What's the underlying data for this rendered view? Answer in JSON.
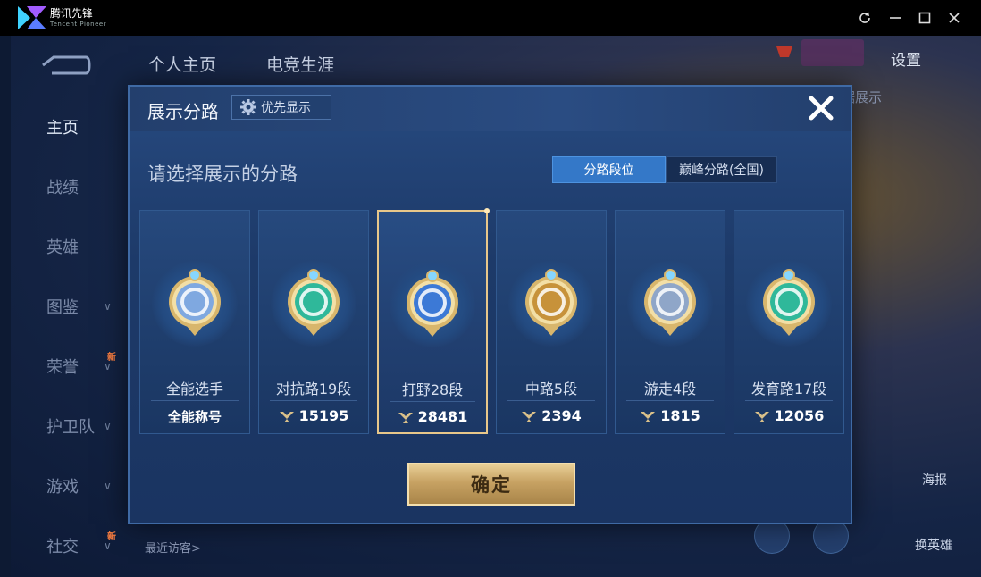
{
  "app": {
    "name": "腾讯先锋",
    "subtitle": "Tencent Pioneer"
  },
  "game": {
    "top_tabs": [
      "个人主页",
      "电竞生涯"
    ],
    "settings_label": "设置",
    "bg_hint": "和数据展示",
    "sidebar": [
      {
        "label": "主页",
        "has_arrow": false,
        "new": false,
        "active": true
      },
      {
        "label": "战绩",
        "has_arrow": false,
        "new": false,
        "active": false
      },
      {
        "label": "英雄",
        "has_arrow": false,
        "new": false,
        "active": false
      },
      {
        "label": "图鉴",
        "has_arrow": true,
        "new": false,
        "active": false
      },
      {
        "label": "荣誉",
        "has_arrow": true,
        "new": true,
        "active": false
      },
      {
        "label": "护卫队",
        "has_arrow": true,
        "new": false,
        "active": false
      },
      {
        "label": "游戏",
        "has_arrow": true,
        "new": false,
        "active": false
      },
      {
        "label": "社交",
        "has_arrow": true,
        "new": true,
        "active": false
      }
    ],
    "new_badge": "新",
    "visitors_label": "最近访客>",
    "poster_label": "海报",
    "switch_label": "换英雄"
  },
  "modal": {
    "title": "展示分路",
    "priority_label": "优先显示",
    "prompt": "请选择展示的分路",
    "segments": [
      "分路段位",
      "巅峰分路(全国)"
    ],
    "confirm_label": "确定",
    "cards": [
      {
        "rank": "全能选手",
        "bottom_text": "全能称号",
        "is_score": false,
        "emblem": "allround-emblem-icon",
        "accent": "#7fa8e0",
        "selected": false
      },
      {
        "rank": "对抗路19段",
        "bottom_text": "15195",
        "is_score": true,
        "emblem": "clash-lane-emblem-icon",
        "accent": "#2fb89a",
        "selected": false
      },
      {
        "rank": "打野28段",
        "bottom_text": "28481",
        "is_score": true,
        "emblem": "jungle-emblem-icon",
        "accent": "#3c79d6",
        "selected": true
      },
      {
        "rank": "中路5段",
        "bottom_text": "2394",
        "is_score": true,
        "emblem": "mid-lane-emblem-icon",
        "accent": "#c7923a",
        "selected": false
      },
      {
        "rank": "游走4段",
        "bottom_text": "1815",
        "is_score": true,
        "emblem": "roam-emblem-icon",
        "accent": "#8fa6c8",
        "selected": false
      },
      {
        "rank": "发育路17段",
        "bottom_text": "12056",
        "is_score": true,
        "emblem": "farm-lane-emblem-icon",
        "accent": "#2fb89a",
        "selected": false
      }
    ]
  }
}
